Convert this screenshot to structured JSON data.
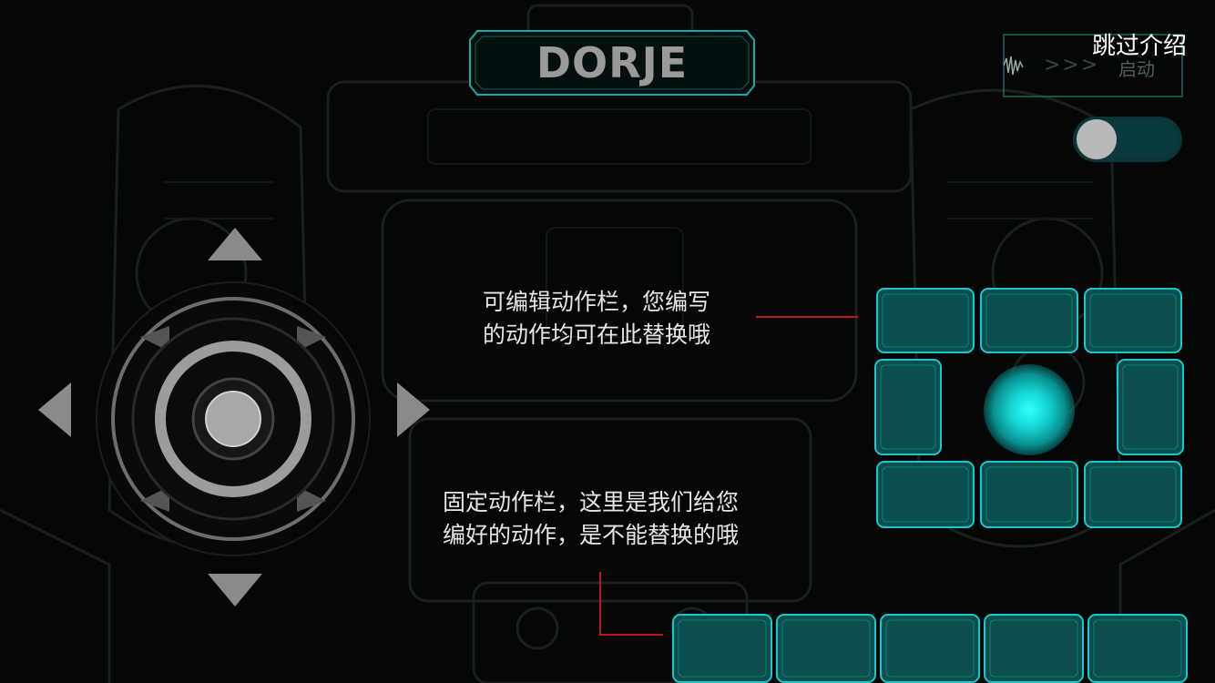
{
  "header": {
    "title": "DORJE",
    "skip_label": "跳过介绍",
    "start_label": "启动",
    "chevrons": ">>>"
  },
  "toggle": {
    "state": "off"
  },
  "joystick": {
    "arrows": [
      "up",
      "down",
      "left",
      "right"
    ]
  },
  "captions": {
    "editable_bar": [
      "可编辑动作栏，您编写",
      "的动作均可在此替换哦"
    ],
    "fixed_bar": [
      "固定动作栏，这里是我们给您",
      "编好的动作，是不能替换的哦"
    ]
  },
  "editable_bar": {
    "slots": 8
  },
  "fixed_bar": {
    "slots": 5
  },
  "colors": {
    "accent": "#19c8c8",
    "tile_fill": "#0c5a5a",
    "callout_line": "#c2161a",
    "toggle_track": "#0b3a3c"
  }
}
